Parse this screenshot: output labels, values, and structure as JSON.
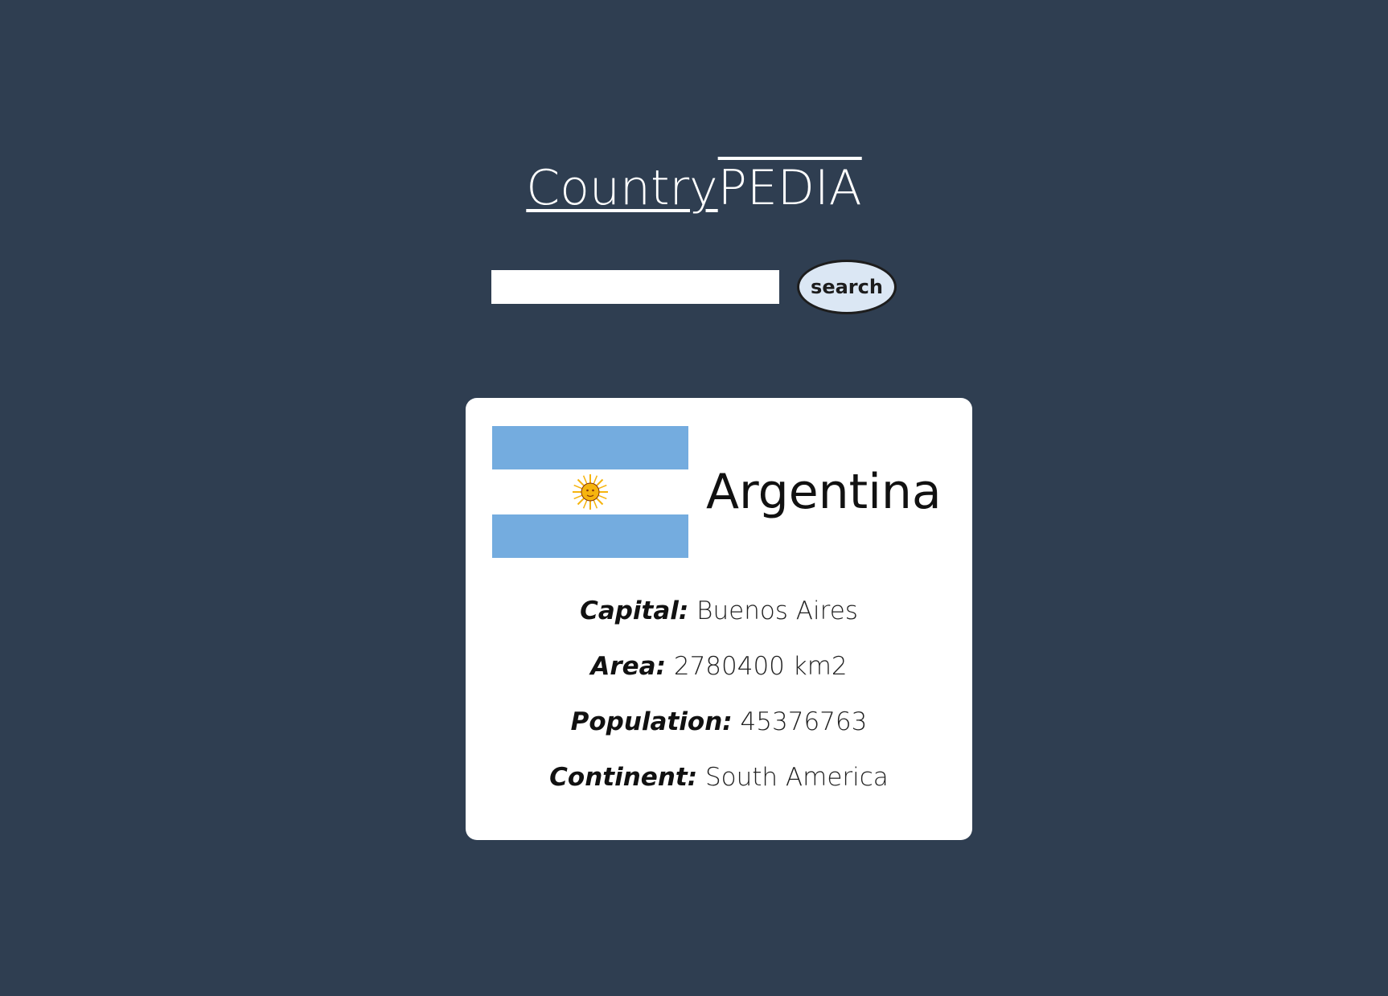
{
  "app": {
    "logo_part1": "Country",
    "logo_part2": "PEDIA"
  },
  "search": {
    "value": "",
    "placeholder": "",
    "button_label": "search"
  },
  "card": {
    "country_name": "Argentina",
    "flag": {
      "stripe_color": "#74acdf",
      "center_color": "#ffffff",
      "sun_color": "#f6b40e"
    },
    "facts": [
      {
        "label": "Capital:",
        "value": "Buenos Aires"
      },
      {
        "label": "Area:",
        "value": "2780400 km2"
      },
      {
        "label": "Population:",
        "value": "45376763"
      },
      {
        "label": "Continent:",
        "value": "South America"
      }
    ]
  },
  "colors": {
    "background": "#2f3e51",
    "card": "#ffffff",
    "button": "#dbe7f4"
  }
}
